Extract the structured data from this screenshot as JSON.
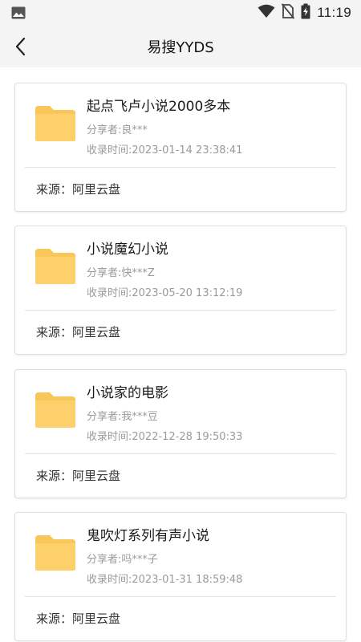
{
  "status_bar": {
    "time": "11:19",
    "icons": [
      "image-icon",
      "wifi-icon",
      "no-sim-icon",
      "battery-charging-icon"
    ]
  },
  "app_bar": {
    "title": "易搜YYDS",
    "back_icon": "chevron-left-icon"
  },
  "colors": {
    "folder": "#fed06b",
    "folder_tab": "#f9c65a",
    "bar_bg": "#f4f4f4"
  },
  "items": [
    {
      "title": "起点飞卢小说2000多本",
      "sharer": "分享者:良***",
      "time": "收录时间:2023-01-14 23:38:41",
      "source": "来源：阿里云盘",
      "icon": "folder-icon"
    },
    {
      "title": "小说魔幻小说",
      "sharer": "分享者:快***Z",
      "time": "收录时间:2023-05-20 13:12:19",
      "source": "来源：阿里云盘",
      "icon": "folder-icon"
    },
    {
      "title": "小说家的电影",
      "sharer": "分享者:我***豆",
      "time": "收录时间:2022-12-28 19:50:33",
      "source": "来源：阿里云盘",
      "icon": "folder-icon"
    },
    {
      "title": "鬼吹灯系列有声小说",
      "sharer": "分享者:吗***子",
      "time": "收录时间:2023-01-31 18:59:48",
      "source": "来源：阿里云盘",
      "icon": "folder-icon"
    }
  ]
}
